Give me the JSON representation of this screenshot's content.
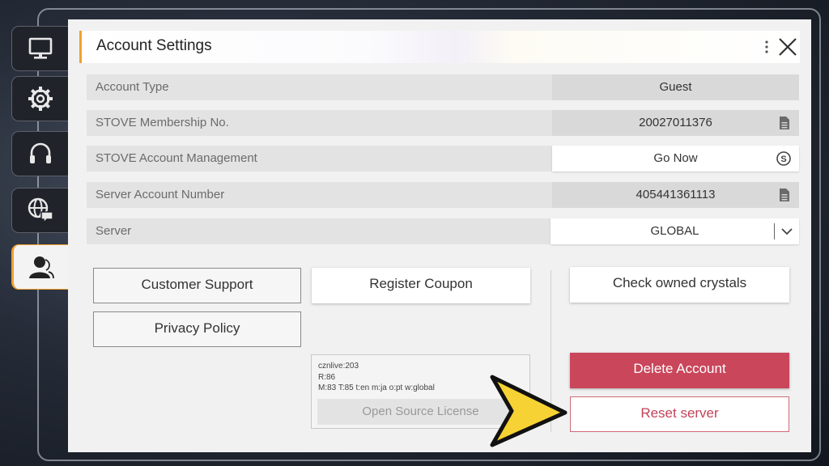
{
  "sidebar": {
    "tabs": [
      {
        "icon": "monitor-icon"
      },
      {
        "icon": "gear-icon"
      },
      {
        "icon": "headphones-icon"
      },
      {
        "icon": "globe-chat-icon"
      },
      {
        "icon": "user-account-icon",
        "active": true
      }
    ]
  },
  "header": {
    "title": "Account Settings"
  },
  "rows": {
    "account_type": {
      "label": "Account Type",
      "value": "Guest"
    },
    "membership_no": {
      "label": "STOVE Membership No.",
      "value": "20027011376"
    },
    "account_mgmt": {
      "label": "STOVE Account Management",
      "value": "Go Now"
    },
    "server_account": {
      "label": "Server Account Number",
      "value": "405441361113"
    },
    "server": {
      "label": "Server",
      "value": "GLOBAL"
    }
  },
  "buttons": {
    "customer_support": "Customer Support",
    "register_coupon": "Register Coupon",
    "check_crystals": "Check owned crystals",
    "privacy_policy": "Privacy Policy",
    "delete_account": "Delete Account",
    "reset_server": "Reset server",
    "open_source": "Open Source License"
  },
  "version_info": {
    "line1": "cznlive:203",
    "line2": "R:86",
    "line3": "M:83 T:85 t:en m:ja o:pt w:global"
  },
  "colors": {
    "accent": "#f0a030",
    "danger": "#c9465b",
    "pointer": "#f6d234"
  }
}
